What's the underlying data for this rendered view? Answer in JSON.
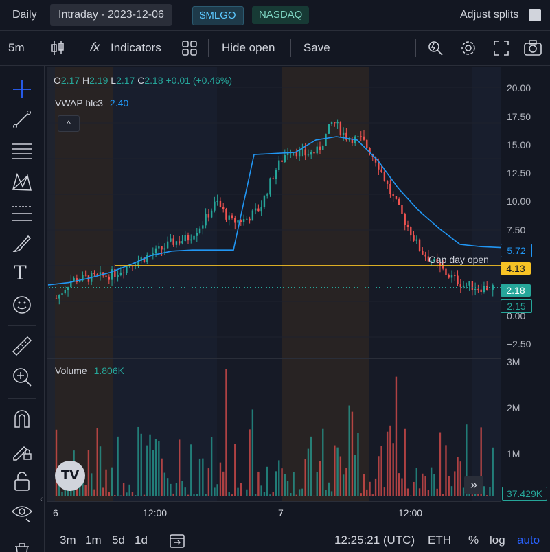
{
  "topbar": {
    "interval_mode": "Daily",
    "date_label": "Intraday - 2023-12-06",
    "symbol": "$MLGO",
    "exchange": "NASDAQ",
    "adjust_splits": "Adjust splits"
  },
  "toolbar": {
    "timeframe": "5m",
    "indicators": "Indicators",
    "hide_open": "Hide open",
    "save": "Save"
  },
  "legend": {
    "ohlc": {
      "o_label": "O",
      "o": "2.17",
      "h_label": "H",
      "h": "2.19",
      "l_label": "L",
      "l": "2.17",
      "c_label": "C",
      "c": "2.18",
      "change": "+0.01",
      "change_pct": "(+0.46%)"
    },
    "vwap_label": "VWAP hlc3",
    "vwap_value": "2.40",
    "volume_label": "Volume",
    "volume_value": "1.806K",
    "gap_label": "Gap day open"
  },
  "price_axis": [
    "20.00",
    "17.50",
    "15.00",
    "12.50",
    "10.00",
    "7.50",
    "0.00",
    "−2.50"
  ],
  "price_tags": {
    "vwap": "5.72",
    "gap": "4.13",
    "last": "2.18",
    "low": "2.15",
    "volume": "37.429K"
  },
  "volume_axis": [
    "3M",
    "2M",
    "1M"
  ],
  "time_axis": [
    "6",
    "12:00",
    "7",
    "12:00"
  ],
  "bottombar": {
    "ranges": [
      "3m",
      "1m",
      "5d",
      "1d"
    ],
    "clock": "12:25:21 (UTC)",
    "session": "ETH",
    "percent": "%",
    "log": "log",
    "auto": "auto"
  },
  "colors": {
    "up": "#26a69a",
    "down": "#ef5350",
    "vwap": "#2196f3",
    "gap": "#f7c325",
    "accent": "#2962ff"
  },
  "chart_data": {
    "type": "candlestick",
    "series": [
      {
        "name": "VWAP hlc3",
        "values": [
          2.4,
          2.6,
          3.0,
          3.5,
          4.2,
          5.0,
          5.4,
          5.5,
          5.5,
          5.5,
          14.0,
          14.1,
          14.2,
          15.3,
          15.6,
          15.3,
          13.5,
          11.0,
          9.0,
          7.4,
          6.0,
          5.8,
          5.72
        ]
      }
    ],
    "price_path": [
      1.2,
      2.8,
      3.0,
      3.1,
      3.4,
      4.2,
      4.8,
      5.4,
      6.2,
      6.5,
      7.8,
      9.8,
      8.0,
      8.2,
      9.2,
      12.5,
      14.6,
      14.0,
      14.3,
      17.0,
      15.5,
      15.3,
      13.5,
      10.5,
      8.0,
      5.5,
      4.3,
      3.2,
      2.4,
      2.17,
      2.18
    ],
    "ylim": [
      -2.5,
      20
    ]
  }
}
